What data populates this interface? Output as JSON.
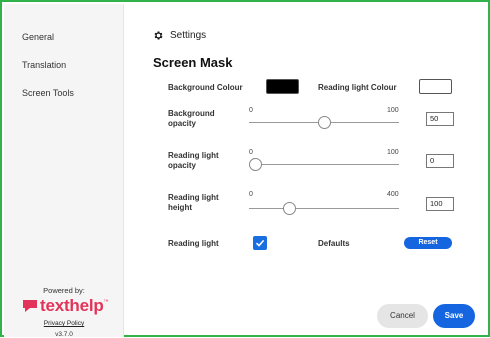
{
  "sidebar": {
    "items": [
      {
        "label": "General"
      },
      {
        "label": "Translation"
      },
      {
        "label": "Screen Tools"
      }
    ],
    "powered_by": "Powered by:",
    "brand": "texthelp",
    "brand_tm": "™",
    "privacy_link": "Privacy Policy",
    "version": "v3.7.0"
  },
  "header": {
    "icon": "gear-icon",
    "title": "Settings"
  },
  "section": {
    "title": "Screen Mask"
  },
  "background_colour": {
    "label": "Background Colour",
    "value": "#000000"
  },
  "reading_light_colour": {
    "label": "Reading light Colour",
    "value": "#ffffff"
  },
  "sliders": [
    {
      "label_line1": "Background",
      "label_line2": "opacity",
      "min": "0",
      "max": "100",
      "value": "50",
      "fraction": 0.5
    },
    {
      "label_line1": "Reading light",
      "label_line2": "opacity",
      "min": "0",
      "max": "100",
      "value": "0",
      "fraction": 0.0
    },
    {
      "label_line1": "Reading light",
      "label_line2": "height",
      "min": "0",
      "max": "400",
      "value": "100",
      "fraction": 0.25
    }
  ],
  "reading_light": {
    "label": "Reading light",
    "checked": true
  },
  "defaults": {
    "label": "Defaults",
    "reset_label": "Reset"
  },
  "footer": {
    "cancel_label": "Cancel",
    "save_label": "Save"
  },
  "colors": {
    "accent": "#1565e0",
    "frame": "#2fb34a",
    "brand": "#e2345a"
  }
}
